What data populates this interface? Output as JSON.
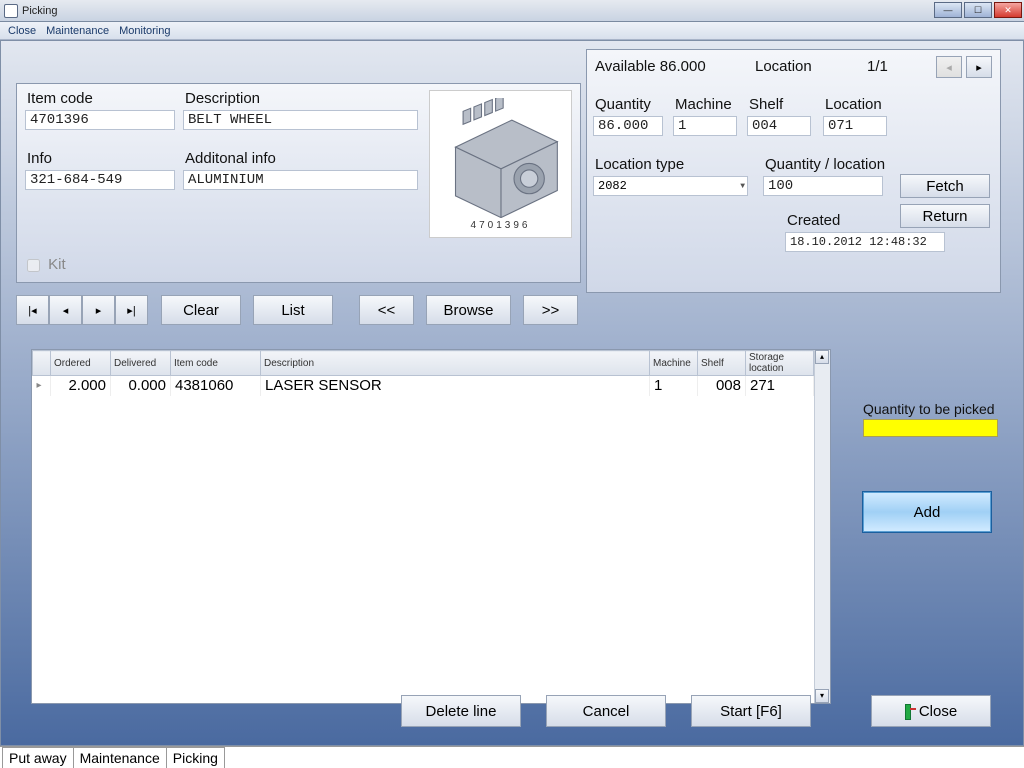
{
  "window": {
    "title": "Picking"
  },
  "menu": {
    "close": "Close",
    "maintenance": "Maintenance",
    "monitoring": "Monitoring"
  },
  "header": {
    "available_label": "Available",
    "available_value": "86.000",
    "location_label": "Location",
    "pager_text": "1/1",
    "pager_prev": "◂",
    "pager_next": "▸"
  },
  "item": {
    "code_label": "Item code",
    "code_value": "4701396",
    "desc_label": "Description",
    "desc_value": "BELT WHEEL",
    "info_label": "Info",
    "info_value": "321-684-549",
    "addl_label": "Additonal info",
    "addl_value": "ALUMINIUM",
    "kit_label": "Kit",
    "image_partno": "4701396"
  },
  "loc": {
    "qty_label": "Quantity",
    "qty_value": "86.000",
    "machine_label": "Machine",
    "machine_value": "1",
    "shelf_label": "Shelf",
    "shelf_value": "004",
    "location_label": "Location",
    "location_value": "071",
    "loctype_label": "Location type",
    "loctype_value": "2082",
    "qtyloc_label": "Quantity / location",
    "qtyloc_value": "100",
    "created_label": "Created",
    "created_value": "18.10.2012 12:48:32",
    "fetch_btn": "Fetch",
    "return_btn": "Return"
  },
  "nav": {
    "first": "|◂",
    "prev": "◂",
    "next": "▸",
    "last": "▸|",
    "clear": "Clear",
    "list": "List",
    "view_prev": "<<",
    "browse": "Browse",
    "view_next": ">>"
  },
  "grid": {
    "headers": {
      "ordered": "Ordered",
      "delivered": "Delivered",
      "itemcode": "Item code",
      "description": "Description",
      "machine": "Machine",
      "shelf": "Shelf",
      "storage": "Storage location"
    },
    "rows": [
      {
        "ordered": "2.000",
        "delivered": "0.000",
        "itemcode": "4381060",
        "description": "LASER SENSOR",
        "machine": "1",
        "shelf": "008",
        "storage": "271"
      }
    ]
  },
  "side": {
    "qpick_label": "Quantity to be picked",
    "qpick_value": "",
    "add_btn": "Add"
  },
  "footer": {
    "delete": "Delete line",
    "cancel": "Cancel",
    "start": "Start [F6]",
    "close": "Close"
  },
  "tabs": {
    "putaway": "Put away",
    "maintenance": "Maintenance",
    "picking": "Picking"
  }
}
